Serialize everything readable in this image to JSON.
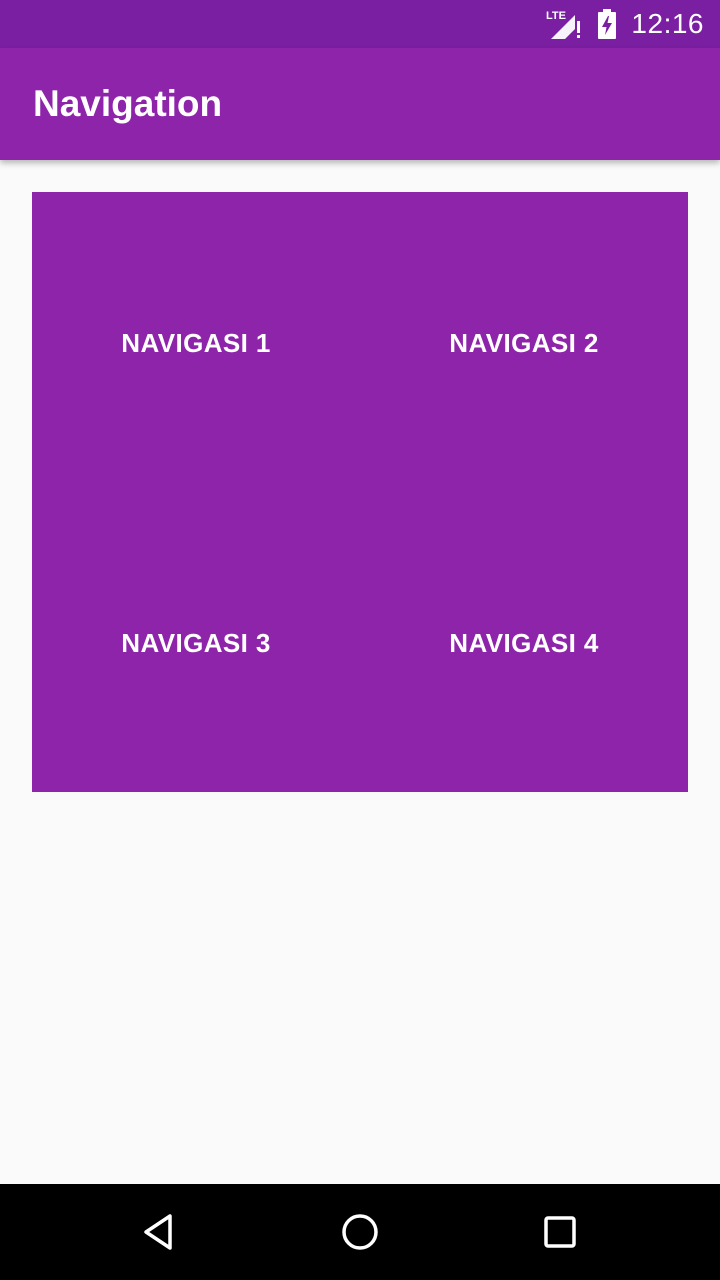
{
  "status_bar": {
    "network": "LTE",
    "time": "12:16"
  },
  "app_bar": {
    "title": "Navigation"
  },
  "navigation_buttons": [
    {
      "label": "NAVIGASI 1"
    },
    {
      "label": "NAVIGASI 2"
    },
    {
      "label": "NAVIGASI 3"
    },
    {
      "label": "NAVIGASI 4"
    }
  ],
  "system_nav": {
    "back_icon": "back-triangle-icon",
    "home_icon": "home-circle-icon",
    "recents_icon": "recents-square-icon"
  },
  "colors": {
    "status_bar": "#7b1fa2",
    "primary": "#8e24aa",
    "background": "#fafafa",
    "text_on_primary": "#ffffff"
  }
}
